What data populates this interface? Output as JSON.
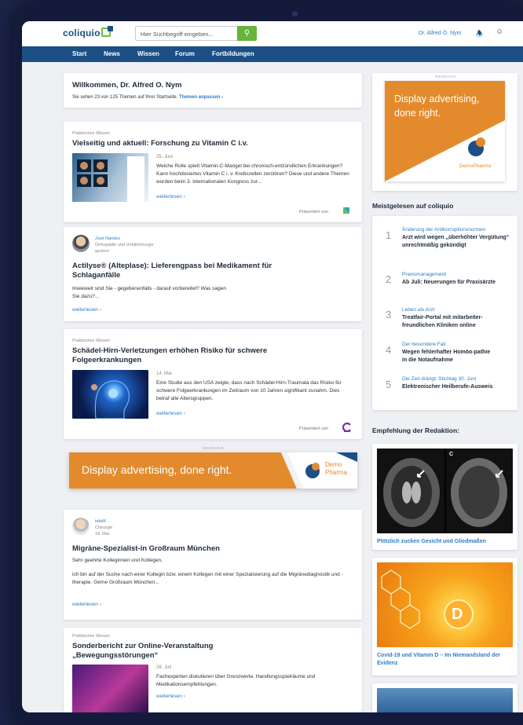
{
  "header": {
    "logo": "coliquio",
    "search_placeholder": "Hier Suchbegriff eingeben...",
    "user_name": "Dr. Alfred O. Nym"
  },
  "nav": [
    "Start",
    "News",
    "Wissen",
    "Forum",
    "Fortbildungen"
  ],
  "welcome": {
    "title": "Willkommen, Dr. Alfred O. Nym",
    "subtitle": "Sie sehen 23 von 125 Themen auf Ihrer Startseite.",
    "link": "Themen anpassen ›"
  },
  "feed": [
    {
      "category": "Praktisches Wissen",
      "title": "Vielseitig und aktuell: Forschung zu Vitamin C i.v.",
      "date": "25. Juni",
      "body": "Welche Rolle spielt Vitamin-C-Mangel bei chronisch-entzündlichen Erkrankungen? Kann hochdosiertes Vitamin C i. v. Krebszellen zerstören? Diese und andere Themen wurden beim 3. internationalen Kongress zur...",
      "more": "weiterlesen ›",
      "presented": "Präsentiert von"
    },
    {
      "author": "José Nandez",
      "role": "Orthopädie und Unfallchirurgie",
      "when": "gestern",
      "title": "Actilyse® (Alteplase): Lieferengpass bei Medikament für Schlaganfälle",
      "body": "Inwieweit sind Sie - gegebenenfalls - darauf vorbereitet? Was sagen Sie dazu?...",
      "more": "weiterlesen ›"
    },
    {
      "category": "Praktisches Wissen",
      "title": "Schädel-Hirn-Verletzungen erhöhen Risiko für schwere Folgeerkrankungen",
      "date": "14. Mai",
      "body": "Eine Studie aus den USA zeigte, dass nach Schädel-Hirn-Traumata das Risiko für schwere Folgeerkrankungen im Zeitraum von 10 Jahren signifikant zunahm. Dies betraf alle Altersgruppen.",
      "more": "weiterlesen ›",
      "presented": "Präsentiert von"
    },
    {
      "author": "tafuM",
      "role": "Chirurgie",
      "when": "18. Mai",
      "title": "Migräne-Spezialist-in Großraum München",
      "body1": "Sehr geehrte Kolleginnen und Kollegen,",
      "body2": "ich bin auf der Suche nach einer Kollegin bzw. einem Kollegen mit einer Spezialisierung auf die Migränediagnostik und -therapie. Gerne Großraum München...",
      "more": "weiterlesen ›"
    },
    {
      "category": "Praktisches Wissen",
      "title": "Sonderbericht zur Online-Veranstaltung „Bewegungsstörungen“",
      "date": "28. Juli",
      "body": "Fachexperten diskutieren über Grenzwerte, Handlungsspielräume und Medikationsempfehlungen.",
      "more": "weiterlesen ›"
    }
  ],
  "ads": {
    "tag": "WERBUNG",
    "headline": "Display advertising, done right.",
    "brand_line1": "Demo",
    "brand_line2": "Pharma",
    "brand": "DemoPharma",
    "orange": "#e38b2c",
    "navy": "#1b4f86"
  },
  "most_read": {
    "heading": "Meistgelesen auf coliquio",
    "items": [
      {
        "rank": "1",
        "category": "Änderung der Antikorruptionsnormen",
        "title": "Arzt wird wegen „überhöhter Vergütung“ unrechtmäßig gekündigt"
      },
      {
        "rank": "2",
        "category": "Praxismanagement",
        "title": "Ab Juli: Neuerungen für Praxisärzte"
      },
      {
        "rank": "3",
        "category": "Leben als Arzt",
        "title": "Treatfair-Portal mit mitarbeiter-freundlichen Kliniken online"
      },
      {
        "rank": "4",
        "category": "Der besondere Fall",
        "title": "Wegen fehlerhafter Homöo-pathie in die Notaufnahme"
      },
      {
        "rank": "5",
        "category": "Die Zeit drängt: Stichtag 30. Juni",
        "title": "Elektronischer Heilberufe-Ausweis"
      }
    ]
  },
  "editor": {
    "heading": "Empfehlung der Redaktion:",
    "items": [
      {
        "title": "Plötzlich zucken Gesicht und Gliedmaßen",
        "mri_label": "C"
      },
      {
        "title": "Covid-19 und Vitamin D – Im Niemandsland der Evidenz",
        "vitamin_letter": "D"
      }
    ]
  }
}
